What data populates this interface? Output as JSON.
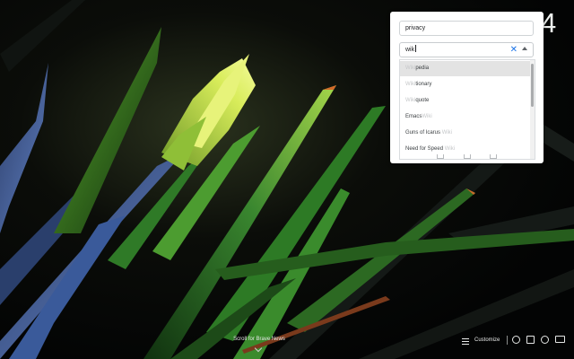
{
  "colors": {
    "accent": "#1a73e8",
    "panel_bg": "#ffffff",
    "selected_option": "#e3e3e3",
    "wallpaper_dark": "#050606",
    "leaf_green": "#2e7d2f",
    "leaf_blue": "#40578f"
  },
  "clock": {
    "visible_digit": "4"
  },
  "search_panel": {
    "top_field_value": "privacy",
    "query_value": "wiki",
    "query_typed": "wik",
    "clear_icon": "close-icon",
    "collapse_icon": "chevron-up-icon",
    "suggestions": [
      {
        "prefix": "",
        "match": "Wiki",
        "suffix": "pedia"
      },
      {
        "prefix": "",
        "match": "Wiki",
        "suffix": "tionary"
      },
      {
        "prefix": "",
        "match": "Wiki",
        "suffix": "quote"
      },
      {
        "prefix": "Emacs",
        "match": "Wiki",
        "suffix": ""
      },
      {
        "prefix": "Guns of Icarus ",
        "match": "Wiki",
        "suffix": ""
      },
      {
        "prefix": "Need for Speed ",
        "match": "Wiki",
        "suffix": ""
      }
    ],
    "selected_index": 0
  },
  "footer": {
    "brave_news_label": "Scroll for Brave News",
    "customize_label": "Customize",
    "icons": [
      "settings-icon",
      "bookmarks-icon",
      "history-icon",
      "media-icon"
    ]
  }
}
